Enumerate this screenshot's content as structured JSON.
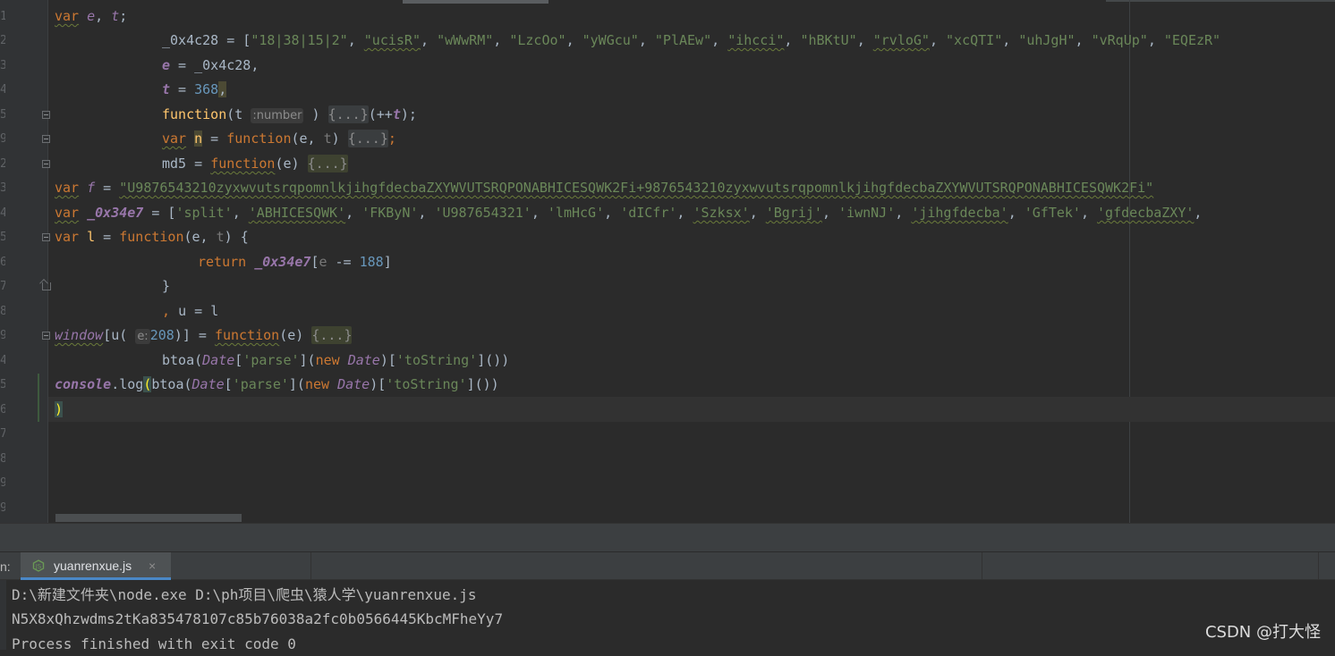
{
  "editor": {
    "line_numbers": [
      "1",
      "2",
      "3",
      "4",
      "5",
      "9",
      "2",
      "3",
      "4",
      "5",
      "6",
      "7",
      "8",
      "9",
      "4",
      "5",
      "6",
      "7",
      "8",
      "9",
      "9"
    ],
    "line1": {
      "kw": "var",
      "v1": "e",
      "comma": ", ",
      "v2": "t",
      "end": ";"
    },
    "line2": {
      "name": "_0x4c28",
      "eq_open": " = [",
      "first": "\"18|38|15|2\"",
      "items": [
        "\"ucisR\"",
        "\"wWwRM\"",
        "\"LzcOo\"",
        "\"yWGcu\"",
        "\"PlAEw\"",
        "\"ihcci\"",
        "\"hBKtU\"",
        "\"rvloG\"",
        "\"xcQTI\"",
        "\"uhJgH\"",
        "\"vRqUp\"",
        "\"EQEzR\""
      ]
    },
    "line3": {
      "v": "e",
      "eq": " = ",
      "rhs": "_0x4c28,"
    },
    "line4": {
      "v": "t",
      "eq": " = ",
      "num": "368",
      "comma": ","
    },
    "line5": {
      "kw": "function",
      "open": "(t",
      "hint": ":number",
      "close": ")",
      "fold": "{...}",
      "tail_open": "(++",
      "tail_var": "t",
      "tail_close": ");"
    },
    "line6": {
      "kw": "var",
      "v": "n",
      "eq": " = ",
      "fkw": "function",
      "params_open": "(e, ",
      "param_t": "t",
      "params_close": ")",
      "fold": "{...}",
      "end": ";"
    },
    "line7": {
      "name": "md5",
      "eq": " = ",
      "fkw": "function",
      "params": "(e)",
      "fold": "{...}"
    },
    "line8": {
      "kw": "var",
      "v": "f",
      "eq": " = ",
      "str": "\"U9876543210zyxwvutsrqpomnlkjihgfdecbaZXYWVUTSRQPONABHICESQWK2Fi+9876543210zyxwvutsrqpomnlkjihgfdecbaZXYWVUTSRQPONABHICESQWK2Fi\""
    },
    "line9": {
      "kw": "var",
      "v": "_0x34e7",
      "eq_open": " = [",
      "items": [
        "'split'",
        "'ABHICESQWK'",
        "'FKByN'",
        "'U987654321'",
        "'lmHcG'",
        "'dICfr'",
        "'Szksx'",
        "'Bgrij'",
        "'iwnNJ'",
        "'jihgfdecba'",
        "'GfTek'",
        "'gfdecbaZXY'"
      ]
    },
    "line10": {
      "kw": "var",
      "v": "l",
      "eq": " = ",
      "fkw": "function",
      "params_open": "(e, ",
      "param_t": "t",
      "params_close": ") {"
    },
    "line11": {
      "kw": "return",
      "v": "_0x34e7",
      "open": "[",
      "e": "e",
      "op": " -= ",
      "num": "188",
      "close": "]"
    },
    "line12": {
      "text": "}"
    },
    "line13": {
      "comma": ", ",
      "u": "u",
      "eq": " = ",
      "l": "l"
    },
    "line14": {
      "win": "window",
      "open": "[",
      "u": "u",
      "paren": "(",
      "hint": "e:",
      "num": "208",
      "close": ")] = ",
      "fkw": "function",
      "params": "(e)",
      "fold": "{...}"
    },
    "line15": {
      "fn": "btoa",
      "o1": "(",
      "date": "Date",
      "b1": "[",
      "s1": "'parse'",
      "b2": "](",
      "newkw": "new",
      "date2": "Date",
      "b3": ")[",
      "s2": "'toString'",
      "end": "]())"
    },
    "line16": {
      "obj": "console",
      "dot": ".",
      "method": "log",
      "paren": "(",
      "fn": "btoa",
      "o1": "(",
      "date": "Date",
      "b1": "[",
      "s1": "'parse'",
      "b2": "](",
      "newkw": "new",
      "date2": "Date",
      "b3": ")[",
      "s2": "'toString'",
      "end": "]())"
    },
    "line17": {
      "paren": ")"
    }
  },
  "run": {
    "label": "n:",
    "tab_label": "yuanrenxue.js",
    "tab_close": "×"
  },
  "console": {
    "lines": [
      "D:\\新建文件夹\\node.exe D:\\ph项目\\爬虫\\猿人学\\yuanrenxue.js",
      "N5X8xQhzwdms2tKa835478107c85b76038a2fc0b0566445KbcMFheYy7",
      "Process finished with exit code 0"
    ]
  },
  "watermark": "CSDN @打大怪",
  "colors": {
    "background": "#2b2b2b",
    "keyword": "#cc7832",
    "string": "#6a8759",
    "number": "#6897bb",
    "variable": "#9876aa",
    "function": "#ffc66d",
    "tab_accent": "#4a88c7"
  }
}
